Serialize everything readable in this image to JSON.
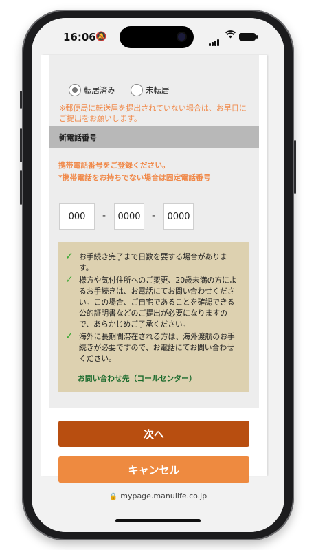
{
  "status_bar": {
    "time": "16:06"
  },
  "form": {
    "moving_options": [
      {
        "label": "転居済み",
        "selected": true
      },
      {
        "label": "未転居",
        "selected": false
      }
    ],
    "moving_note": "※郵便局に転送届を提出されていない場合は、お早目にご提出をお願いします。",
    "phone_section_title": "新電話番号",
    "phone_instruction_1": "携帯電話番号をご登録ください。",
    "phone_instruction_2": "*携帯電話をお持ちでない場合は固定電話番号",
    "phone_fields": [
      {
        "placeholder": "000"
      },
      {
        "placeholder": "0000"
      },
      {
        "placeholder": "0000"
      }
    ],
    "separator": "-"
  },
  "info": {
    "items": [
      "お手続き完了まで日数を要する場合があります。",
      "様方や気付住所へのご変更、20歳未満の方によるお手続きは、お電話にてお問い合わせください。この場合、ご自宅であることを確認できる公的証明書などのご提出が必要になりますので、あらかじめご了承ください。",
      "海外に長期間滞在される方は、海外渡航のお手続きが必要ですので、お電話にてお問い合わせください。"
    ],
    "contact_link": "お問い合わせ先（コールセンター）"
  },
  "buttons": {
    "next": "次へ",
    "cancel": "キャンセル"
  },
  "browser": {
    "url": "mypage.manulife.co.jp"
  },
  "colors": {
    "accent_orange": "#f08a4b",
    "next_button": "#b84e10",
    "cancel_button": "#ee8a40",
    "check_green": "#3aa832",
    "link_green": "#1b6b2d",
    "info_bg": "#ddd1b0"
  }
}
